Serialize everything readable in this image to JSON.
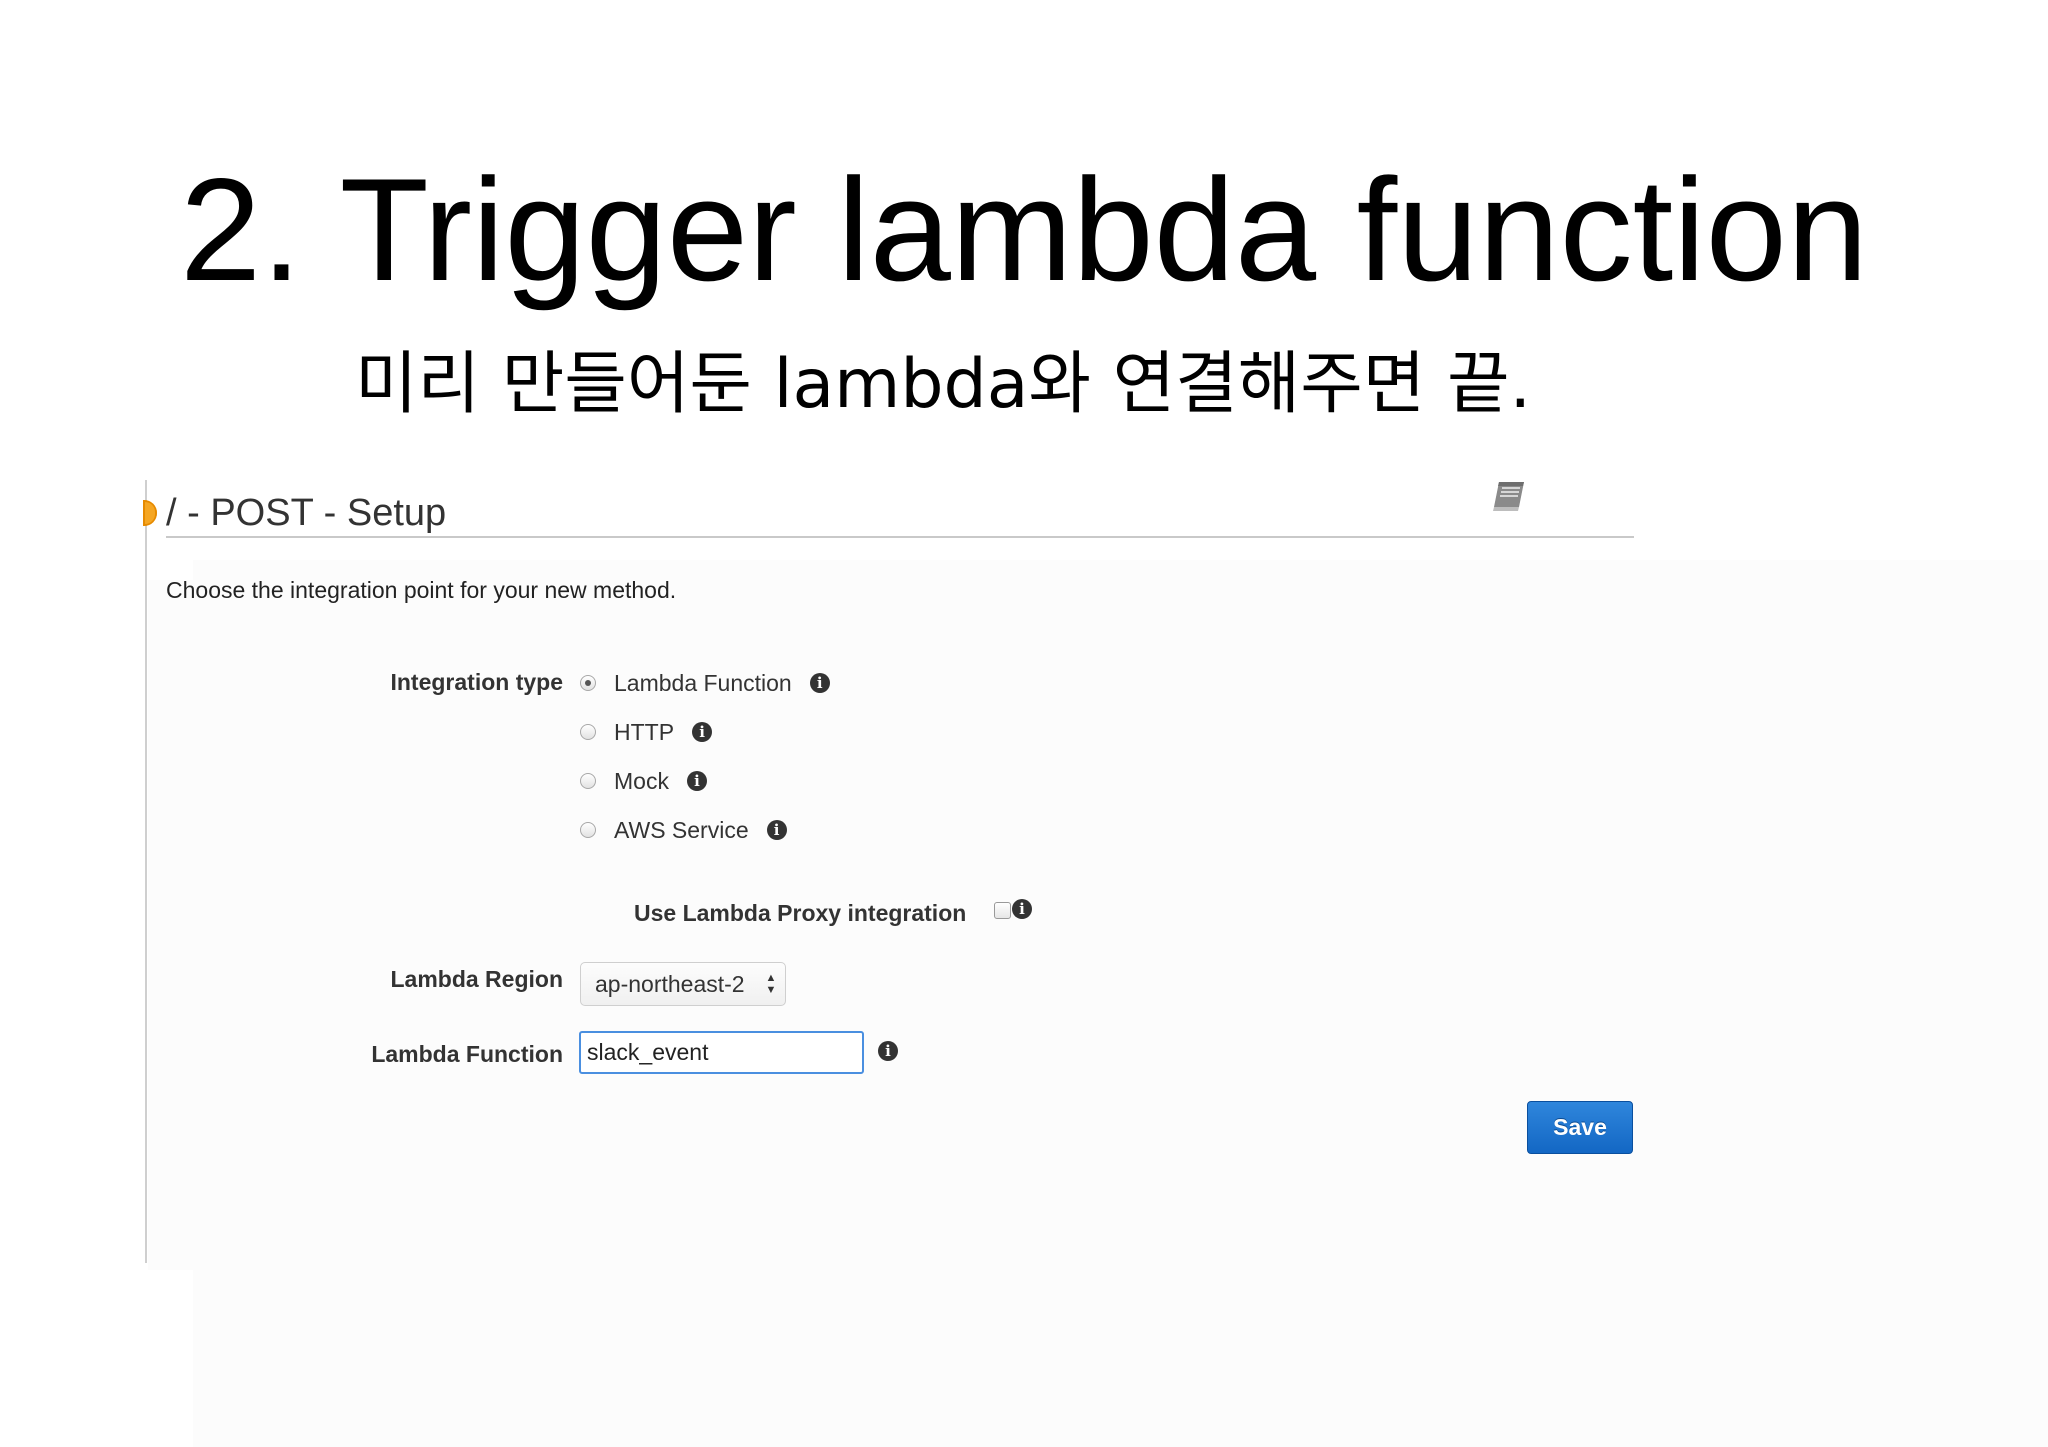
{
  "slide": {
    "title": "2. Trigger lambda function",
    "subtitle": "미리 만들어둔 lambda와 연결해주면 끝."
  },
  "panel": {
    "heading": "/ - POST - Setup",
    "intro": "Choose the integration point for your new method.",
    "help_icon": "book-icon",
    "status_color": "#f5a623"
  },
  "form": {
    "integration_type_label": "Integration type",
    "integration_options": [
      {
        "label": "Lambda Function",
        "selected": true
      },
      {
        "label": "HTTP",
        "selected": false
      },
      {
        "label": "Mock",
        "selected": false
      },
      {
        "label": "AWS Service",
        "selected": false
      }
    ],
    "proxy_label": "Use Lambda Proxy integration",
    "proxy_checked": false,
    "region_label": "Lambda Region",
    "region_value": "ap-northeast-2",
    "function_label": "Lambda Function",
    "function_value": "slack_event",
    "info_icon": "info-icon"
  },
  "actions": {
    "save_label": "Save",
    "save_color": "#1a73d0"
  }
}
